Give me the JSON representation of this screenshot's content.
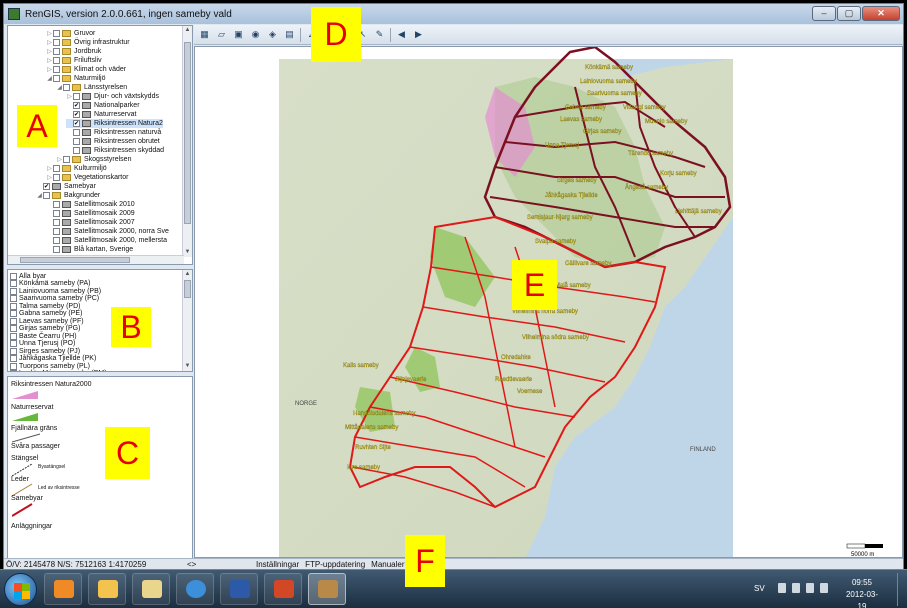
{
  "window": {
    "title": "RenGIS, version 2.0.0.661, ingen sameby vald",
    "min": "–",
    "max": "▢",
    "close": "✕"
  },
  "layer_tree": [
    {
      "label": "Gruvor",
      "indent": 1,
      "tri": "▷",
      "check": "",
      "icon": "folder"
    },
    {
      "label": "Övrig infrastruktur",
      "indent": 1,
      "tri": "▷",
      "check": "",
      "icon": "folder"
    },
    {
      "label": "Jordbruk",
      "indent": 1,
      "tri": "▷",
      "check": "",
      "icon": "folder"
    },
    {
      "label": "Friluftsliv",
      "indent": 1,
      "tri": "▷",
      "check": "",
      "icon": "folder"
    },
    {
      "label": "Klimat och väder",
      "indent": 1,
      "tri": "▷",
      "check": "",
      "icon": "folder"
    },
    {
      "label": "Naturmiljö",
      "indent": 1,
      "tri": "◢",
      "check": "",
      "icon": "folder"
    },
    {
      "label": "Länsstyrelsen",
      "indent": 2,
      "tri": "◢",
      "check": "",
      "icon": "folder"
    },
    {
      "label": "Djur- och växtskydds",
      "indent": 3,
      "tri": "▷",
      "check": "",
      "icon": "layer"
    },
    {
      "label": "Nationalparker",
      "indent": 3,
      "tri": "",
      "check": "✔",
      "icon": "layer"
    },
    {
      "label": "Naturreservat",
      "indent": 3,
      "tri": "",
      "check": "✔",
      "icon": "layer"
    },
    {
      "label": "Riksintressen Natura2",
      "indent": 3,
      "tri": "",
      "check": "✔",
      "icon": "layer",
      "selected": true
    },
    {
      "label": "Riksintressen naturvå",
      "indent": 3,
      "tri": "",
      "check": "",
      "icon": "layer"
    },
    {
      "label": "Riksintressen obrutet",
      "indent": 3,
      "tri": "",
      "check": "",
      "icon": "layer"
    },
    {
      "label": "Riksintressen skyddad",
      "indent": 3,
      "tri": "",
      "check": "",
      "icon": "layer"
    },
    {
      "label": "Skogsstyrelsen",
      "indent": 2,
      "tri": "▷",
      "check": "",
      "icon": "folder"
    },
    {
      "label": "Kulturmiljö",
      "indent": 1,
      "tri": "▷",
      "check": "",
      "icon": "folder"
    },
    {
      "label": "Vegetationskartor",
      "indent": 1,
      "tri": "▷",
      "check": "",
      "icon": "folder"
    },
    {
      "label": "Samebyar",
      "indent": 0,
      "tri": "",
      "check": "✔",
      "icon": "layer"
    },
    {
      "label": "Bakgrunder",
      "indent": 0,
      "tri": "◢",
      "check": "",
      "icon": "folder"
    },
    {
      "label": "Satellitmosaik 2010",
      "indent": 1,
      "tri": "",
      "check": "",
      "icon": "layer"
    },
    {
      "label": "Satellitmosaik 2009",
      "indent": 1,
      "tri": "",
      "check": "",
      "icon": "layer"
    },
    {
      "label": "Satellitmosaik 2007",
      "indent": 1,
      "tri": "",
      "check": "",
      "icon": "layer"
    },
    {
      "label": "Satellitmosaik 2000, norra Sve",
      "indent": 1,
      "tri": "",
      "check": "",
      "icon": "layer"
    },
    {
      "label": "Satellitmosaik 2000, mellersta",
      "indent": 1,
      "tri": "",
      "check": "",
      "icon": "layer"
    },
    {
      "label": "Blå kartan, Sverige",
      "indent": 1,
      "tri": "",
      "check": "",
      "icon": "layer"
    }
  ],
  "sameby_list": [
    "Alla byar",
    "Könkämä sameby (PA)",
    "Lainiovuoma sameby (PB)",
    "Saarivuoma sameby (PC)",
    "Talma sameby (PD)",
    "Gabna sameby (PE)",
    "Laevas sameby (PF)",
    "Girjas sameby (PG)",
    "Baste Čearru (PH)",
    "Unna Tjerusj (PO)",
    "Sirges sameby (PJ)",
    "Jåhkågaska Tjiellde (PK)",
    "Tuorpons sameby (PL)",
    "Luokta-Mávas sameby (PM)"
  ],
  "legend": {
    "natura": "Riksintressen Natura2000",
    "naturreservat": "Naturreservat",
    "fjallnara": "Fjällnära gräns",
    "svara": "Svåra passager",
    "stangsel": "Stängsel",
    "byastangsel": "Byastängsel",
    "leder": "Leder",
    "led_riks": "Led av riksintresse",
    "samebyar": "Samebyar",
    "anlaggningar": "Anläggningar"
  },
  "toolbar_icons": [
    "map-icon",
    "open-folder-icon",
    "save-icon",
    "globe-icon",
    "layers-icon",
    "print-icon",
    "measure-icon",
    "zoom-icon",
    "pan-icon",
    "select-icon",
    "edit-icon",
    "back-icon",
    "forward-icon"
  ],
  "map": {
    "sameby_labels": [
      "Könkämä sameby",
      "Lainiovuoma sameby",
      "Saarivuoma sameby",
      "Gabna sameby",
      "Vittangi sameby",
      "Laevas sameby",
      "Muonio sameby",
      "Girjas sameby",
      "Unna Tjerusj",
      "Tärendö sameby",
      "Korju sameby",
      "Sirges sameby",
      "Ängeså sameby",
      "Jåhkågaska Tjiellde",
      "Liehittäjä sameby",
      "Semisjaur-Njarg sameby",
      "Svaipa sameby",
      "Gällivare sameby",
      "Malå sameby",
      "Vapsten",
      "Vilhelmina norra sameby",
      "Vilhelmina södra sameby",
      "Ohredahke",
      "Raedtievaerie",
      "Voernese",
      "Kalls sameby",
      "Jiijnjevaerie",
      "Handölsdalens sameby",
      "Mittådalens sameby",
      "Ruvhten Sijte",
      "Idre sameby"
    ],
    "country_labels": [
      "NORGE",
      "FINLAND"
    ],
    "scale": "50000 m"
  },
  "markers": {
    "a": "A",
    "b": "B",
    "c": "C",
    "d": "D",
    "e": "E",
    "f": "F"
  },
  "status": {
    "coords": "Ö/V: 2145478 N/S: 7512163 1:4170259",
    "tab1": "Inställningar",
    "tab2": "FTP-uppdatering",
    "tab3": "Manualer",
    "pager": "<>"
  },
  "taskbar": {
    "lang": "SV",
    "time": "09:55",
    "date": "2012-03-19"
  },
  "colors": {
    "sameby_north": "#7a1020",
    "sameby_south": "#e01818",
    "natura": "#e48fd0",
    "reserve": "#93c560",
    "label": "#f4e81c",
    "marker_bg": "#ffff00",
    "marker_fg": "#e60000"
  }
}
